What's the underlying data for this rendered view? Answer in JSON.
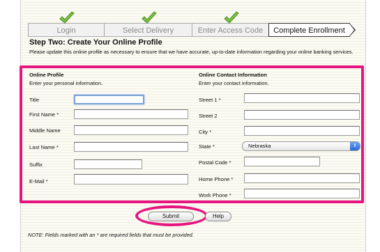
{
  "steps": [
    {
      "label": "Login",
      "completed": true
    },
    {
      "label": "Select Delivery",
      "completed": true
    },
    {
      "label": "Enter Access Code",
      "completed": true
    },
    {
      "label": "Complete Enrollment",
      "completed": false,
      "current": true
    }
  ],
  "heading": "Step Two: Create Your Online Profile",
  "intro": "Please update this online profile as necessary to ensure that we have accurate, up-to-date information regarding your online banking services.",
  "profile": {
    "title": "Online Profile",
    "subtitle": "Enter your personal information.",
    "fields": {
      "title": "Title",
      "first_name": "First Name *",
      "middle_name": "Middle Name",
      "last_name": "Last Name *",
      "suffix": "Suffix",
      "email": "E-Mail *"
    }
  },
  "contact": {
    "title": "Online Contact Information",
    "subtitle": "Enter your contact information.",
    "fields": {
      "street1": "Street 1 *",
      "street2": "Street 2",
      "city": "City *",
      "state": "State *",
      "postal": "Postal Code *",
      "home_phone": "Home Phone *",
      "work_phone": "Work Phone *"
    },
    "state_value": "Nebraska"
  },
  "buttons": {
    "submit": "Submit",
    "help": "Help"
  },
  "note": "NOTE: Fields marked with an * are required fields that must be provided.",
  "colors": {
    "highlight": "#e6157f",
    "check": "#7bc043"
  },
  "icons": {
    "completed_step": "checkmark-icon",
    "dropdown": "updown-arrow-icon"
  }
}
